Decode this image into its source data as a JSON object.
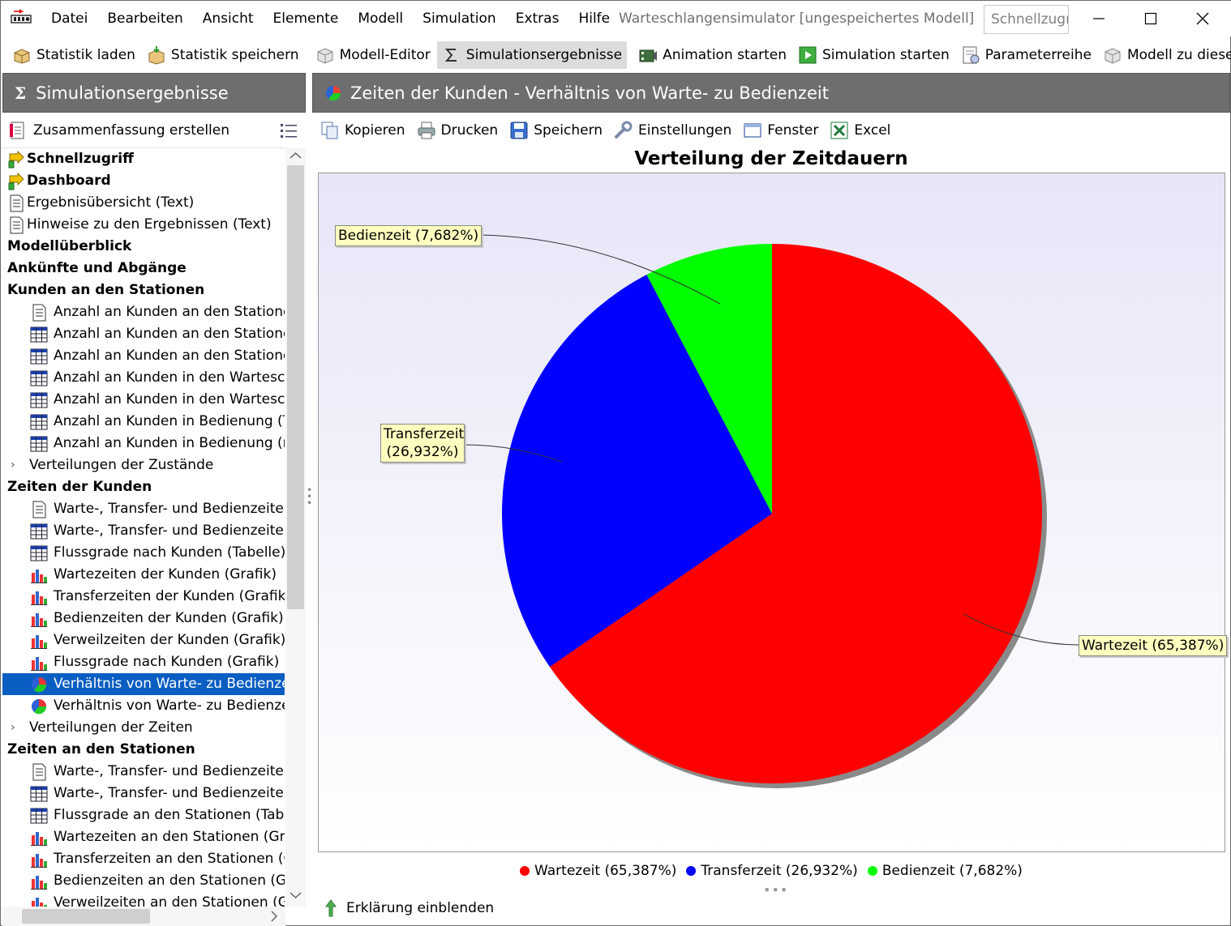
{
  "menu": [
    "Datei",
    "Bearbeiten",
    "Ansicht",
    "Elemente",
    "Modell",
    "Simulation",
    "Extras",
    "Hilfe"
  ],
  "window_title": "Warteschlangensimulator [ungespeichertes Modell]",
  "quick_access_placeholder": "Schnellzugriff",
  "toolbar": {
    "stat_load": "Statistik laden",
    "stat_save": "Statistik speichern",
    "model_editor": "Modell-Editor",
    "sim_results": "Simulationsergebnisse",
    "anim_start": "Animation starten",
    "sim_start": "Simulation starten",
    "param_series": "Parameterreihe",
    "model_to_results": "Modell zu diesen Ergebnissen"
  },
  "left_panel": {
    "title": "Simulationsergebnisse",
    "summary_button": "Zusammenfassung erstellen",
    "tree": [
      {
        "label": "Schnellzugriff",
        "kind": "bold",
        "icon": "quick-access-icon"
      },
      {
        "label": "Dashboard",
        "kind": "bold",
        "icon": "dashboard-icon"
      },
      {
        "label": "Ergebnisübersicht (Text)",
        "kind": "top",
        "icon": "text-doc-icon"
      },
      {
        "label": "Hinweise zu den Ergebnissen (Text)",
        "kind": "top",
        "icon": "text-doc-icon"
      },
      {
        "label": "Modellüberblick",
        "kind": "header"
      },
      {
        "label": "Ankünfte und Abgänge",
        "kind": "header"
      },
      {
        "label": "Kunden an den Stationen",
        "kind": "header"
      },
      {
        "label": "Anzahl an Kunden an den Stationen",
        "kind": "child",
        "icon": "text-doc-icon"
      },
      {
        "label": "Anzahl an Kunden an den Stationen",
        "kind": "child",
        "icon": "table-icon"
      },
      {
        "label": "Anzahl an Kunden an den Stationen",
        "kind": "child",
        "icon": "table-icon"
      },
      {
        "label": "Anzahl an Kunden in den Warteschla",
        "kind": "child",
        "icon": "table-icon"
      },
      {
        "label": "Anzahl an Kunden in den Warteschla",
        "kind": "child",
        "icon": "table-icon"
      },
      {
        "label": "Anzahl an Kunden in Bedienung (Tab",
        "kind": "child",
        "icon": "table-icon"
      },
      {
        "label": "Anzahl an Kunden in Bedienung (nac",
        "kind": "child",
        "icon": "table-icon"
      },
      {
        "label": "Verteilungen der Zustände",
        "kind": "expander"
      },
      {
        "label": "Zeiten der Kunden",
        "kind": "header"
      },
      {
        "label": "Warte-, Transfer- und Bedienzeiten d",
        "kind": "child",
        "icon": "text-doc-icon"
      },
      {
        "label": "Warte-, Transfer- und Bedienzeiten d",
        "kind": "child",
        "icon": "table-icon"
      },
      {
        "label": "Flussgrade nach Kunden (Tabelle)",
        "kind": "child",
        "icon": "table-icon"
      },
      {
        "label": "Wartezeiten der Kunden (Grafik)",
        "kind": "child",
        "icon": "bar-chart-icon"
      },
      {
        "label": "Transferzeiten der Kunden (Grafik)",
        "kind": "child",
        "icon": "bar-chart-icon"
      },
      {
        "label": "Bedienzeiten der Kunden (Grafik)",
        "kind": "child",
        "icon": "bar-chart-icon"
      },
      {
        "label": "Verweilzeiten der Kunden (Grafik)",
        "kind": "child",
        "icon": "bar-chart-icon"
      },
      {
        "label": "Flussgrade nach Kunden (Grafik)",
        "kind": "child",
        "icon": "bar-chart-icon"
      },
      {
        "label": "Verhältnis von Warte- zu Bedienzeit (",
        "kind": "child",
        "icon": "pie-chart-icon",
        "selected": true
      },
      {
        "label": "Verhältnis von Warte- zu Bedienzeit (",
        "kind": "child",
        "icon": "pie-chart-icon"
      },
      {
        "label": "Verteilungen der Zeiten",
        "kind": "expander"
      },
      {
        "label": "Zeiten an den Stationen",
        "kind": "header"
      },
      {
        "label": "Warte-, Transfer- und Bedienzeiten a",
        "kind": "child",
        "icon": "text-doc-icon"
      },
      {
        "label": "Warte-, Transfer- und Bedienzeiten a",
        "kind": "child",
        "icon": "table-icon"
      },
      {
        "label": "Flussgrade an den Stationen (Tabelle",
        "kind": "child",
        "icon": "table-icon"
      },
      {
        "label": "Wartezeiten an den Stationen (Grafik",
        "kind": "child",
        "icon": "bar-chart-icon"
      },
      {
        "label": "Transferzeiten an den Stationen (Gra",
        "kind": "child",
        "icon": "bar-chart-icon"
      },
      {
        "label": "Bedienzeiten an den Stationen (Grafi",
        "kind": "child",
        "icon": "bar-chart-icon"
      },
      {
        "label": "Verweilzeiten an den Stationen (Grafi",
        "kind": "child",
        "icon": "bar-chart-icon"
      }
    ]
  },
  "right_panel": {
    "title": "Zeiten der Kunden - Verhältnis von Warte- zu Bedienzeit",
    "tools": {
      "copy": "Kopieren",
      "print": "Drucken",
      "save": "Speichern",
      "settings": "Einstellungen",
      "window": "Fenster",
      "excel": "Excel"
    },
    "explain": "Erklärung einblenden"
  },
  "chart_data": {
    "type": "pie",
    "title": "Verteilung der Zeitdauern",
    "slices": [
      {
        "name": "Wartezeit",
        "value": 65.387,
        "label": "Wartezeit (65,387%)",
        "color": "#ff0000"
      },
      {
        "name": "Transferzeit",
        "value": 26.932,
        "label": "Transferzeit (26,932%)",
        "color": "#0000ff"
      },
      {
        "name": "Bedienzeit",
        "value": 7.682,
        "label": "Bedienzeit (7,682%)",
        "color": "#00ff00"
      }
    ],
    "legend_position": "bottom"
  }
}
